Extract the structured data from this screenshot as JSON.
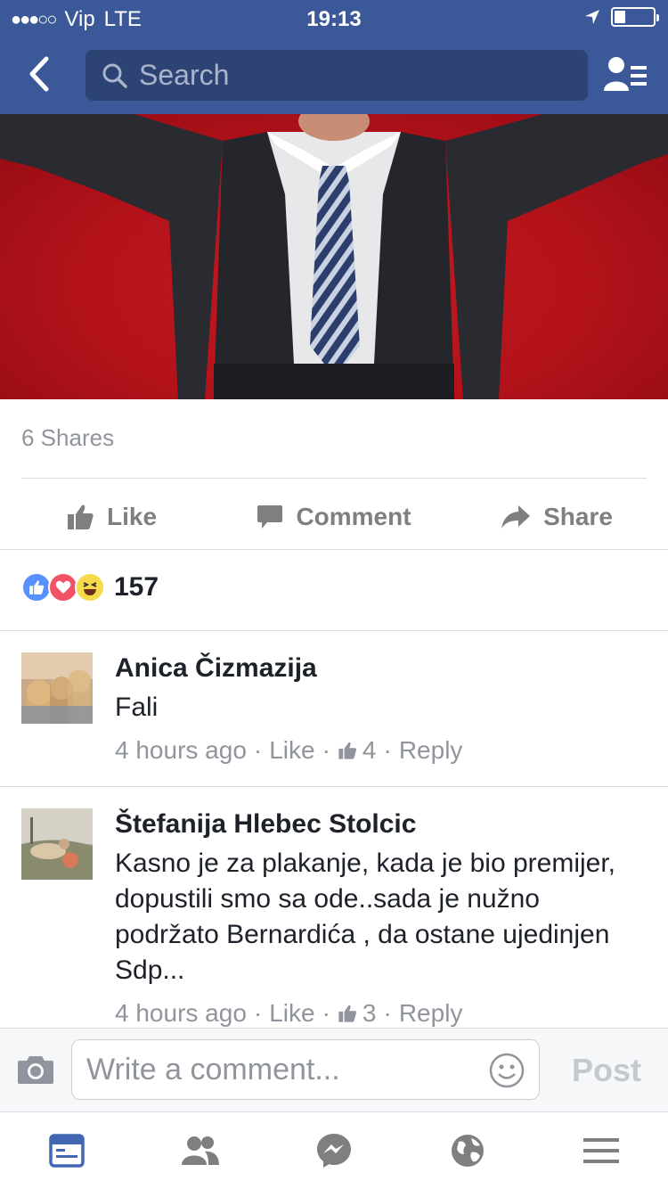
{
  "status_bar": {
    "carrier": "Vip",
    "network": "LTE",
    "time": "19:13"
  },
  "navbar": {
    "search_placeholder": "Search"
  },
  "post": {
    "shares": "6 Shares",
    "actions": {
      "like": "Like",
      "comment": "Comment",
      "share": "Share"
    },
    "reactions_count": "157"
  },
  "comments": [
    {
      "name": "Anica Čizmazija",
      "text": "Fali",
      "time": "4 hours ago",
      "like": "Like",
      "likes": "4",
      "reply": "Reply"
    },
    {
      "name": "Štefanija Hlebec Stolcic",
      "text": "Kasno je za plakanje, kada je bio premijer, dopustili smo sa ode..sada je nužno podržato Bernardića , da ostane ujedinjen Sdp...",
      "time": "4 hours ago",
      "like": "Like",
      "likes": "3",
      "reply": "Reply"
    }
  ],
  "composer": {
    "placeholder": "Write a comment...",
    "post_label": "Post"
  },
  "colors": {
    "brand": "#3b5998",
    "active_tab": "#4267b2",
    "muted": "#90949c"
  },
  "tabs": [
    "news-feed",
    "friends",
    "messenger",
    "notifications",
    "menu"
  ]
}
